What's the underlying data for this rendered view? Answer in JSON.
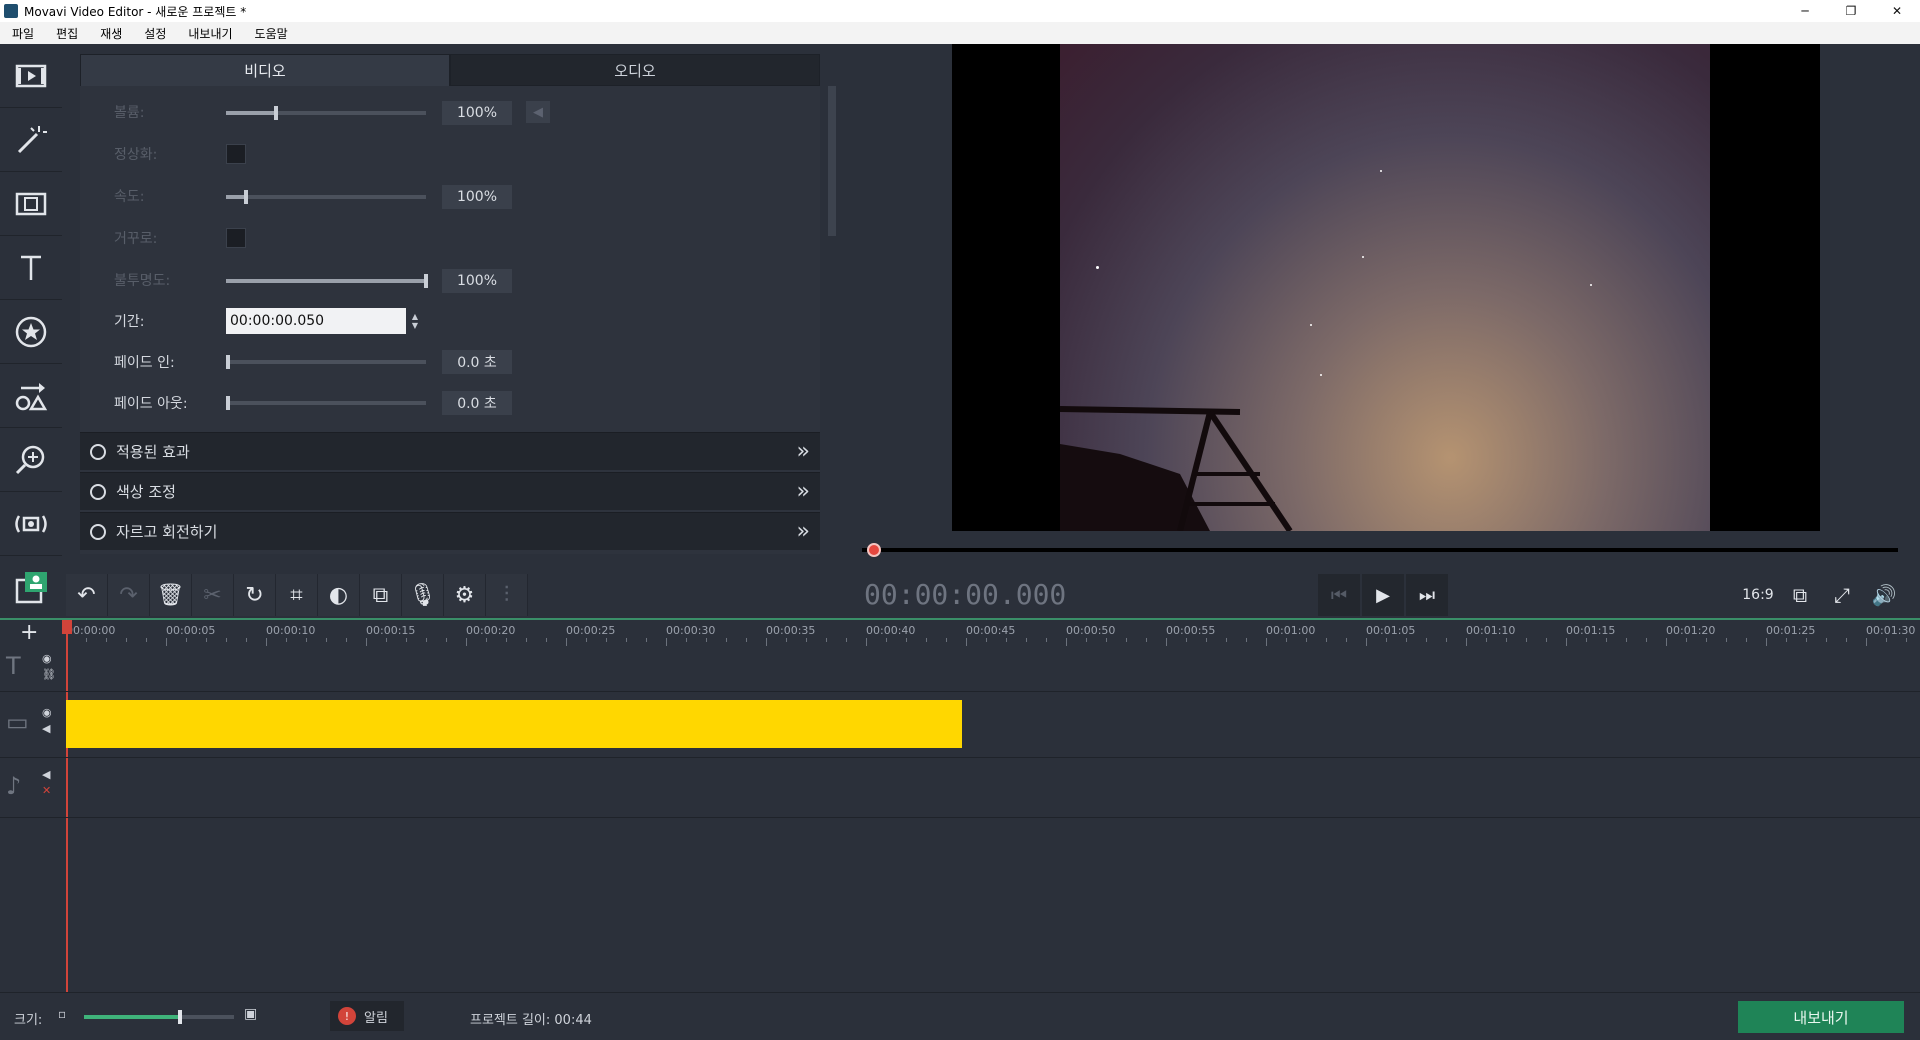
{
  "window": {
    "title": "Movavi Video Editor - 새로운 프로젝트 *",
    "minimize": "─",
    "restore": "❐",
    "close": "✕"
  },
  "menu": [
    "파일",
    "편집",
    "재생",
    "설정",
    "내보내기",
    "도움말"
  ],
  "props": {
    "tabs": [
      {
        "label": "비디오",
        "active": true
      },
      {
        "label": "오디오",
        "active": false
      }
    ],
    "volume": {
      "label": "볼륨:",
      "value": "100%",
      "level": 0.25
    },
    "normalize": {
      "label": "정상화:"
    },
    "speed": {
      "label": "속도:",
      "value": "100%",
      "level": 0.1
    },
    "reverse": {
      "label": "거꾸로:"
    },
    "opacity": {
      "label": "불투명도:",
      "value": "100%",
      "level": 1.0
    },
    "duration": {
      "label": "기간:",
      "value": "00:00:00.050"
    },
    "fade_in": {
      "label": "페이드 인:",
      "value": "0.0 초",
      "level": 0
    },
    "fade_out": {
      "label": "페이드 아웃:",
      "value": "0.0 초",
      "level": 0
    },
    "sections": [
      {
        "label": "적용된 효과"
      },
      {
        "label": "색상 조정"
      },
      {
        "label": "자르고 회전하기"
      }
    ]
  },
  "player": {
    "timecode": "00:00:00.000",
    "aspect": "16:9"
  },
  "timeline": {
    "ticks": [
      "00:00:00",
      "00:00:05",
      "00:00:10",
      "00:00:15",
      "00:00:20",
      "00:00:25",
      "00:00:30",
      "00:00:35",
      "00:00:40",
      "00:00:45",
      "00:00:50",
      "00:00:55",
      "00:01:00",
      "00:01:05",
      "00:01:10",
      "00:01:15",
      "00:01:20",
      "00:01:25",
      "00:01:30"
    ],
    "clip_color": "#ffd700"
  },
  "bottom": {
    "zoom_label": "크기:",
    "alert_label": "알림",
    "project_length": "프로젝트 길이: 00:44",
    "export_label": "내보내기"
  }
}
